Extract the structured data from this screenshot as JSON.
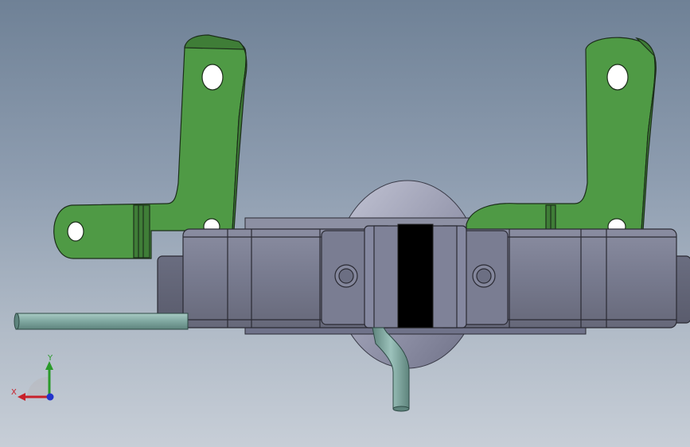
{
  "viewport": {
    "background_top": "#6f8196",
    "background_bottom": "#c7ced7"
  },
  "model": {
    "bracket_color": "#4f9a45",
    "bracket_edge": "#1c2e1a",
    "housing_color": "#7c7f93",
    "housing_edge": "#2a2a33",
    "tube_color": "#7fa7a0",
    "slot_color": "#000000"
  },
  "triad": {
    "x_label": "X",
    "y_label": "Y",
    "x_color": "#c8202a",
    "y_color": "#2a9a2a",
    "z_color": "#2233cc"
  }
}
